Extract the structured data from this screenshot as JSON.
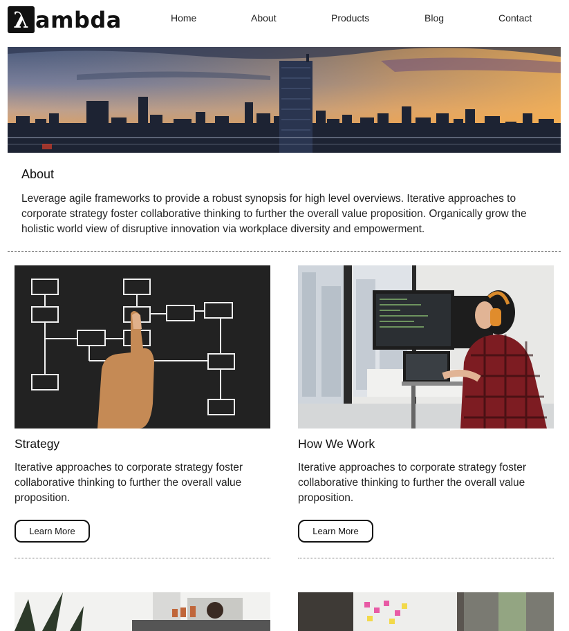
{
  "logo": {
    "mark": "λ",
    "text": "ambda"
  },
  "nav": {
    "items": [
      "Home",
      "About",
      "Products",
      "Blog",
      "Contact"
    ]
  },
  "hero": {
    "alt": "city skyline at sunset"
  },
  "about": {
    "title": "About",
    "text": "Leverage agile frameworks to provide a robust synopsis for high level overviews. Iterative approaches to corporate strategy foster collaborative thinking to further the overall value proposition. Organically grow the holistic world view of disruptive innovation via workplace diversity and empowerment."
  },
  "cards": [
    {
      "title": "Strategy",
      "text": "Iterative approaches to corporate strategy foster collaborative thinking to further the overall value proposition.",
      "button": "Learn More"
    },
    {
      "title": "How We Work",
      "text": "Iterative approaches to corporate strategy foster collaborative thinking to further the overall value proposition.",
      "button": "Learn More"
    }
  ],
  "colors": {
    "text": "#111111",
    "background": "#ffffff",
    "border": "#111111"
  }
}
